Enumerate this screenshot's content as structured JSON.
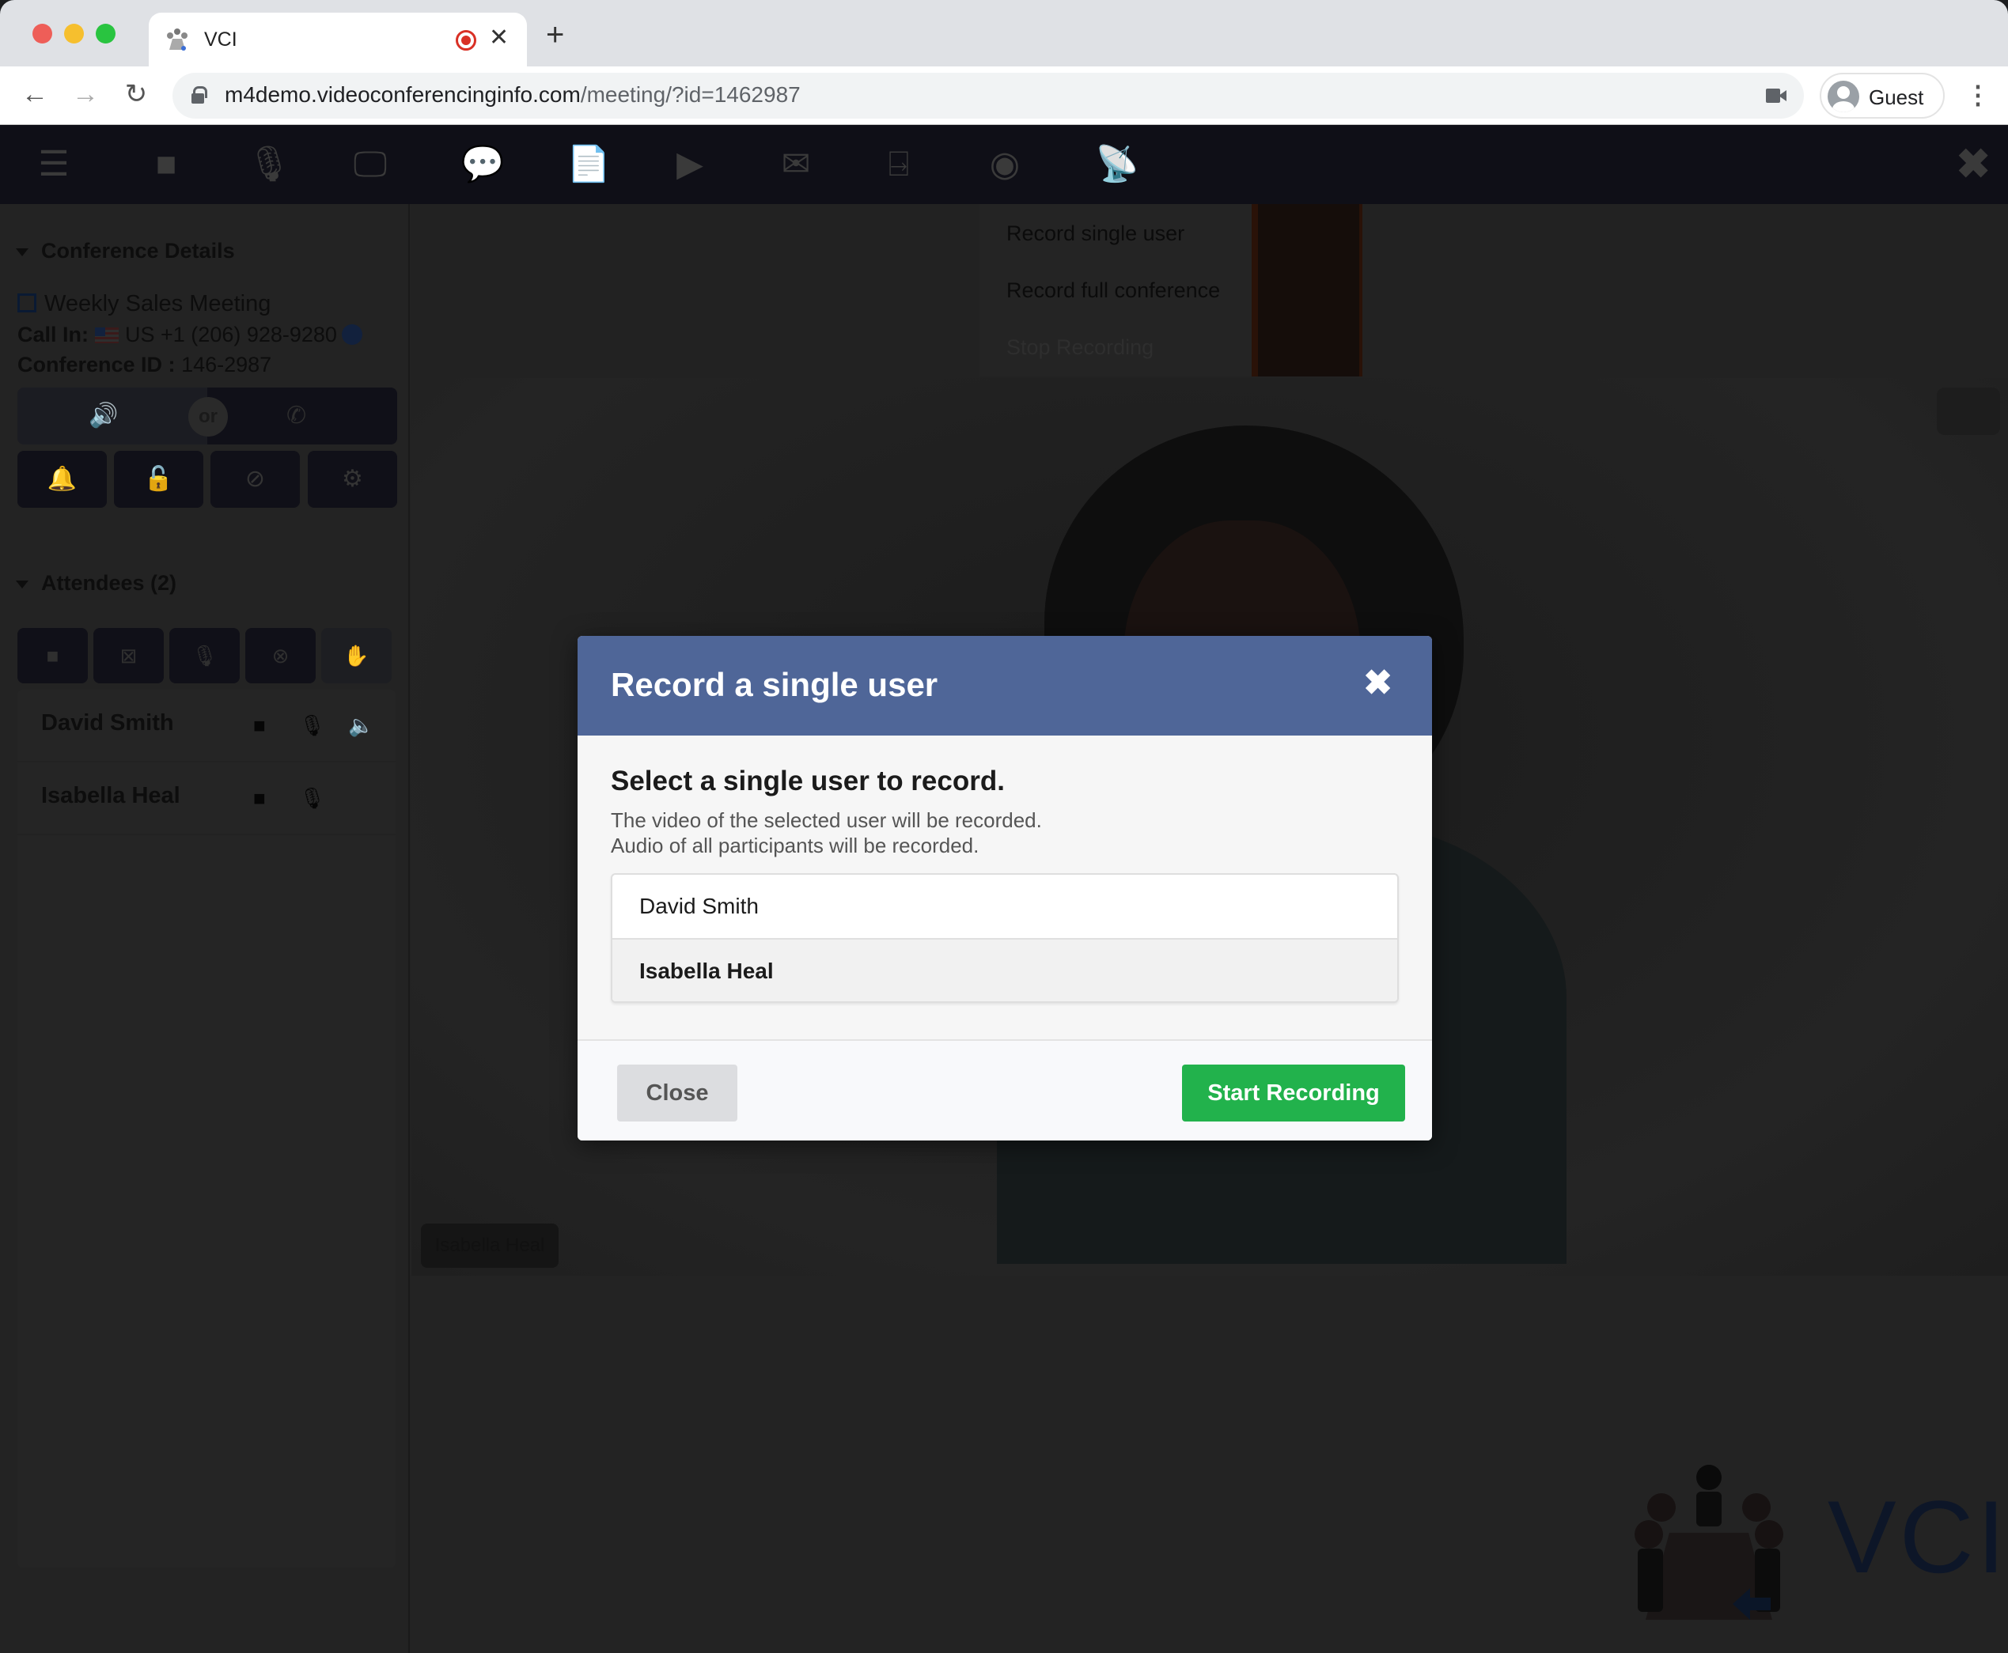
{
  "browser": {
    "tab_title": "VCI",
    "tab_recording": true,
    "new_tab_symbol": "+",
    "url_host": "m4demo.videoconferencinginfo.com",
    "url_path": "/meeting/?id=1462987",
    "profile_name": "Guest",
    "icons": {
      "back": "←",
      "forward": "→",
      "reload": "↻",
      "close_tab": "✕",
      "menu": "⋮"
    }
  },
  "toolbar": {
    "items": [
      {
        "name": "menu-icon",
        "glyph": "☰"
      },
      {
        "name": "video-camera-icon",
        "glyph": "■"
      },
      {
        "name": "microphone-icon",
        "glyph": "🎙"
      },
      {
        "name": "screen-share-icon",
        "glyph": "🖵"
      },
      {
        "name": "chat-icon",
        "glyph": "💬"
      },
      {
        "name": "document-icon",
        "glyph": "📄"
      },
      {
        "name": "media-play-icon",
        "glyph": "▶"
      },
      {
        "name": "envelope-icon",
        "glyph": "✉"
      },
      {
        "name": "exit-door-icon",
        "glyph": "⍈"
      },
      {
        "name": "record-icon",
        "glyph": "◉"
      },
      {
        "name": "broadcast-icon",
        "glyph": "📡"
      }
    ],
    "close_glyph": "✖"
  },
  "recording_menu": {
    "items": [
      {
        "label": "Record single user",
        "enabled": true
      },
      {
        "label": "Record full conference",
        "enabled": true
      },
      {
        "label": "Stop Recording",
        "enabled": false
      }
    ]
  },
  "sidebar": {
    "conference_section": "Conference Details",
    "meeting_name": "Weekly Sales Meeting",
    "call_in_label": "Call In:",
    "call_in_number": "US +1 (206) 928-9280",
    "conference_id_label": "Conference ID :",
    "conference_id": "146-2987",
    "audio_or": "or",
    "audio_icons": {
      "computer": "🔊",
      "phone": "✆"
    },
    "control_buttons": [
      {
        "name": "bell-icon",
        "glyph": "🔔"
      },
      {
        "name": "unlock-icon",
        "glyph": "🔓"
      },
      {
        "name": "block-icon",
        "glyph": "⊘"
      },
      {
        "name": "gear-icon",
        "glyph": "⚙"
      }
    ],
    "attendees_section": "Attendees (2)",
    "attendee_controls": [
      {
        "name": "all-video-on-icon",
        "glyph": "■"
      },
      {
        "name": "all-video-off-icon",
        "glyph": "⊠"
      },
      {
        "name": "all-mic-on-icon",
        "glyph": "🎙"
      },
      {
        "name": "all-mic-off-icon",
        "glyph": "⊗"
      },
      {
        "name": "raise-hand-icon",
        "glyph": "✋"
      }
    ],
    "attendees": [
      {
        "name": "David Smith",
        "video": true,
        "mic": true,
        "speaking": true
      },
      {
        "name": "Isabella Heal",
        "video": true,
        "mic": true,
        "speaking": false
      }
    ]
  },
  "video": {
    "tile_label": "Isabella Heal"
  },
  "logo": {
    "text": "VCI"
  },
  "modal": {
    "title": "Record a single user",
    "close_glyph": "✖",
    "heading": "Select a single user to record.",
    "description_lines": [
      "The video of the selected user will be recorded.",
      "Audio of all participants will be recorded."
    ],
    "users": [
      {
        "name": "David Smith",
        "selected": false
      },
      {
        "name": "Isabella Heal",
        "selected": true
      }
    ],
    "close_label": "Close",
    "start_label": "Start Recording",
    "colors": {
      "header": "#4f6698",
      "start_button": "#22b24c"
    }
  }
}
